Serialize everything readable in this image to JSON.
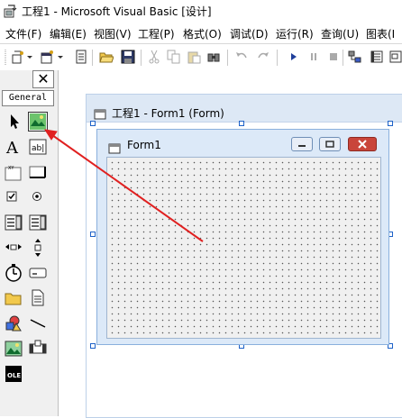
{
  "window": {
    "title": "工程1 - Microsoft Visual Basic [设计]"
  },
  "menu": [
    "文件(F)",
    "编辑(E)",
    "视图(V)",
    "工程(P)",
    "格式(O)",
    "调试(D)",
    "运行(R)",
    "查询(U)",
    "图表(I"
  ],
  "toolbar": {
    "icons": [
      "add-project-icon",
      "dropdown-arrow-icon",
      "add-form-icon",
      "dropdown-arrow-icon",
      "menu-editor-icon",
      "open-icon",
      "save-icon",
      "cut-icon",
      "copy-icon",
      "paste-icon",
      "find-icon",
      "undo-icon",
      "redo-icon",
      "start-icon",
      "break-icon",
      "end-icon",
      "project-explorer-icon",
      "properties-icon",
      "form-layout-icon"
    ]
  },
  "toolbox": {
    "tab_label": "General",
    "close_label": "✕",
    "tools": [
      "pointer",
      "picturebox",
      "label",
      "textbox",
      "frame",
      "commandbutton",
      "checkbox",
      "optionbutton",
      "combobox",
      "listbox",
      "hscrollbar",
      "vscrollbar",
      "timer",
      "drivelistbox",
      "dirlistbox",
      "filelistbox",
      "shape",
      "line",
      "image",
      "data",
      "ole"
    ]
  },
  "designer": {
    "title": "工程1 - Form1 (Form)"
  },
  "form": {
    "title": "Form1"
  },
  "annotation": {
    "color": "#e02020"
  },
  "colors": {
    "selection_handle": "#1e62c8",
    "close_button": "#c9453a"
  }
}
